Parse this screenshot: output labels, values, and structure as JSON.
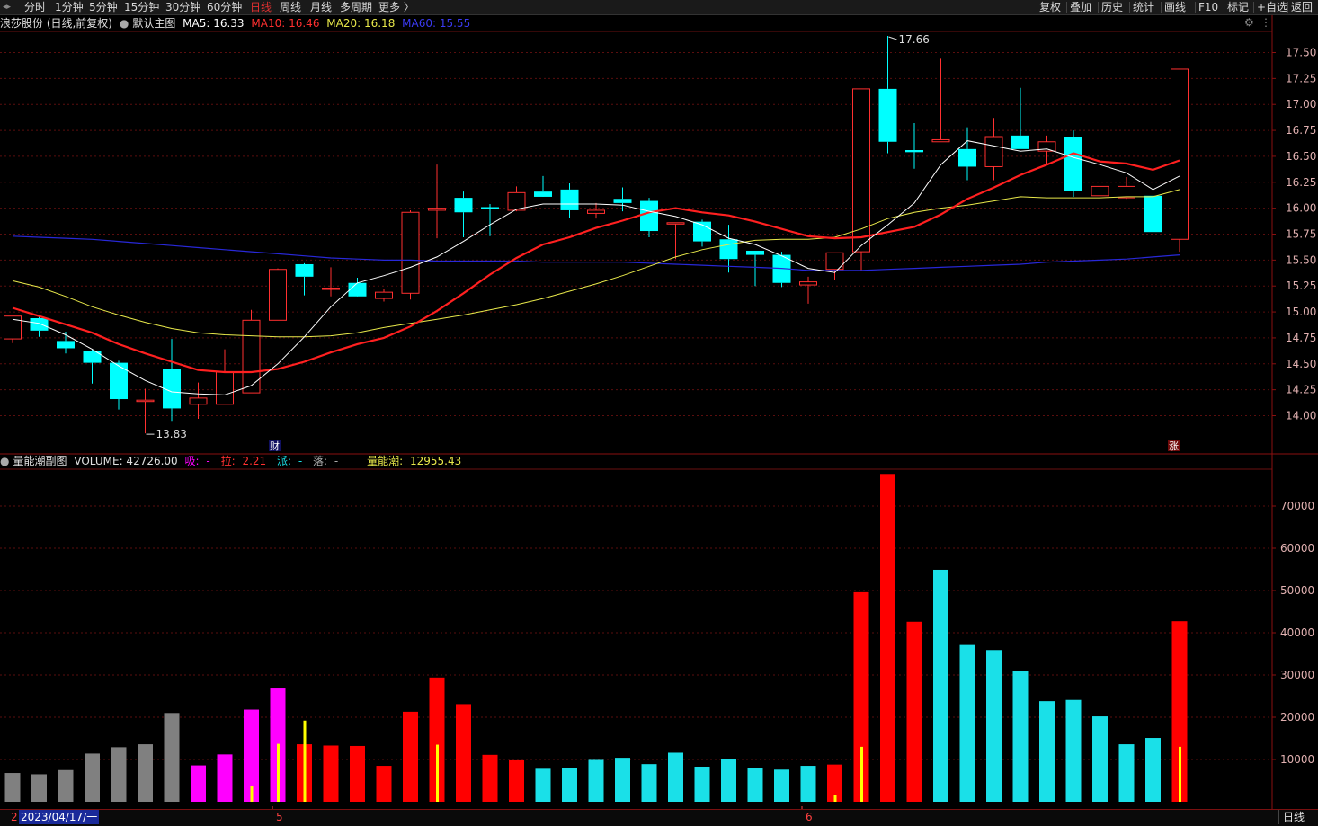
{
  "toolbar": {
    "periods": [
      "分时",
      "1分钟",
      "5分钟",
      "15分钟",
      "30分钟",
      "60分钟",
      "日线",
      "周线",
      "月线",
      "多周期",
      "更多 〉"
    ],
    "active_period": "日线",
    "right_buttons": [
      "复权",
      "叠加",
      "历史",
      "统计",
      "画线",
      "F10",
      "标记",
      "+自选",
      "返回"
    ]
  },
  "main_legend": {
    "stock": "浪莎股份 (日线,前复权)",
    "indicator": "默认主图",
    "ma5": "MA5: 16.33",
    "ma10": "MA10: 16.46",
    "ma20": "MA20: 16.18",
    "ma60": "MA60: 15.55"
  },
  "sub_legend": {
    "name": "量能潮副图",
    "volume": "VOLUME: 42726.00",
    "xi_label": "吸:",
    "xi_val": "-",
    "la_label": "拉:",
    "la_val": "2.21",
    "pai_label": "派:",
    "pai_val": "-",
    "luo_label": "落:",
    "luo_val": "-",
    "lnc_label": "量能潮:",
    "lnc_val": "12955.43"
  },
  "colors": {
    "up": "#ff3030",
    "down": "#00ffff",
    "ma5": "#ffffff",
    "ma10": "#ff2020",
    "ma20": "#e8e84a",
    "ma60": "#2828d8",
    "vol_gray": "#808080",
    "vol_magenta": "#ff00ff",
    "vol_red": "#ff0000",
    "vol_cyan": "#1ae0e8",
    "vol_yellow": "#ffff00"
  },
  "annotations": {
    "low": "13.83",
    "high": "17.66",
    "marker_cai": "财",
    "marker_zhang": "涨"
  },
  "bottom": {
    "date": "2023/04/17/一",
    "left_stub": "2",
    "month5": "5",
    "month6": "6",
    "mode": "日线"
  },
  "chart_data": [
    {
      "type": "candlestick",
      "ylim": [
        13.6,
        17.9
      ],
      "y_ticks": [
        "17.50",
        "17.25",
        "17.00",
        "16.75",
        "16.50",
        "16.25",
        "16.00",
        "15.75",
        "15.50",
        "15.25",
        "15.00",
        "14.75",
        "14.50",
        "14.25",
        "14.00"
      ],
      "ohlc": [
        [
          14.74,
          14.96,
          14.7,
          14.96
        ],
        [
          14.94,
          14.97,
          14.76,
          14.82
        ],
        [
          14.72,
          14.81,
          14.6,
          14.65
        ],
        [
          14.62,
          14.64,
          14.31,
          14.51
        ],
        [
          14.51,
          14.53,
          14.06,
          14.16
        ],
        [
          14.15,
          14.26,
          13.83,
          14.15
        ],
        [
          14.45,
          14.74,
          13.95,
          14.07
        ],
        [
          14.11,
          14.32,
          13.97,
          14.17
        ],
        [
          14.11,
          14.64,
          14.11,
          14.42
        ],
        [
          14.22,
          15.02,
          14.22,
          14.92
        ],
        [
          14.92,
          15.42,
          14.92,
          15.41
        ],
        [
          15.46,
          15.47,
          15.16,
          15.34
        ],
        [
          15.23,
          15.43,
          15.15,
          15.23
        ],
        [
          15.28,
          15.33,
          15.17,
          15.15
        ],
        [
          15.13,
          15.22,
          15.1,
          15.19
        ],
        [
          15.18,
          15.98,
          15.12,
          15.96
        ],
        [
          15.98,
          16.42,
          15.71,
          16.0
        ],
        [
          16.1,
          16.16,
          15.72,
          15.96
        ],
        [
          16.01,
          16.04,
          15.73,
          15.99
        ],
        [
          15.98,
          16.21,
          15.97,
          16.15
        ],
        [
          16.16,
          16.31,
          16.13,
          16.11
        ],
        [
          16.18,
          16.24,
          15.91,
          15.98
        ],
        [
          15.95,
          16.05,
          15.9,
          15.98
        ],
        [
          16.09,
          16.2,
          15.97,
          16.05
        ],
        [
          16.07,
          16.1,
          15.72,
          15.78
        ],
        [
          15.86,
          15.86,
          15.51,
          15.86
        ],
        [
          15.87,
          15.89,
          15.63,
          15.68
        ],
        [
          15.7,
          15.84,
          15.38,
          15.51
        ],
        [
          15.59,
          15.59,
          15.25,
          15.55
        ],
        [
          15.55,
          15.58,
          15.24,
          15.28
        ],
        [
          15.26,
          15.34,
          15.08,
          15.29
        ],
        [
          15.41,
          15.54,
          15.31,
          15.57
        ],
        [
          15.58,
          17.15,
          15.4,
          17.15
        ],
        [
          17.15,
          17.66,
          16.53,
          16.64
        ],
        [
          16.56,
          16.82,
          16.38,
          16.54
        ],
        [
          16.64,
          17.44,
          16.64,
          16.66
        ],
        [
          16.57,
          16.78,
          16.27,
          16.4
        ],
        [
          16.4,
          16.87,
          16.27,
          16.69
        ],
        [
          16.7,
          17.16,
          16.57,
          16.57
        ],
        [
          16.55,
          16.7,
          16.43,
          16.64
        ],
        [
          16.69,
          16.75,
          16.11,
          16.17
        ],
        [
          16.12,
          16.34,
          16.0,
          16.21
        ],
        [
          16.1,
          16.3,
          16.09,
          16.21
        ],
        [
          16.12,
          16.2,
          15.73,
          15.77
        ],
        [
          15.7,
          17.34,
          15.58,
          17.34
        ]
      ],
      "ma5": [
        14.93,
        14.89,
        14.78,
        14.64,
        14.48,
        14.34,
        14.23,
        14.21,
        14.2,
        14.29,
        14.5,
        14.76,
        15.05,
        15.28,
        15.35,
        15.43,
        15.53,
        15.68,
        15.84,
        15.99,
        16.04,
        16.04,
        16.04,
        16.03,
        15.97,
        15.92,
        15.84,
        15.71,
        15.65,
        15.54,
        15.42,
        15.38,
        15.64,
        15.84,
        16.05,
        16.42,
        16.65,
        16.6,
        16.55,
        16.57,
        16.49,
        16.42,
        16.34,
        16.18,
        16.31
      ],
      "ma10": [
        15.04,
        14.96,
        14.88,
        14.8,
        14.69,
        14.6,
        14.52,
        14.44,
        14.42,
        14.42,
        14.45,
        14.52,
        14.61,
        14.69,
        14.75,
        14.86,
        15.01,
        15.18,
        15.36,
        15.52,
        15.65,
        15.72,
        15.81,
        15.88,
        15.96,
        16.0,
        15.96,
        15.93,
        15.87,
        15.8,
        15.73,
        15.71,
        15.72,
        15.77,
        15.82,
        15.94,
        16.09,
        16.2,
        16.32,
        16.42,
        16.53,
        16.45,
        16.43,
        16.37,
        16.46
      ],
      "ma20": [
        15.3,
        15.24,
        15.15,
        15.05,
        14.97,
        14.9,
        14.84,
        14.8,
        14.78,
        14.77,
        14.76,
        14.76,
        14.77,
        14.8,
        14.85,
        14.89,
        14.93,
        14.97,
        15.02,
        15.07,
        15.13,
        15.2,
        15.27,
        15.35,
        15.44,
        15.53,
        15.6,
        15.65,
        15.69,
        15.7,
        15.7,
        15.72,
        15.8,
        15.9,
        15.96,
        16.0,
        16.03,
        16.07,
        16.11,
        16.1,
        16.1,
        16.1,
        16.11,
        16.11,
        16.18
      ],
      "ma60": [
        15.73,
        15.72,
        15.71,
        15.7,
        15.68,
        15.66,
        15.64,
        15.62,
        15.6,
        15.58,
        15.56,
        15.54,
        15.52,
        15.51,
        15.5,
        15.5,
        15.49,
        15.49,
        15.49,
        15.49,
        15.48,
        15.48,
        15.48,
        15.48,
        15.47,
        15.46,
        15.45,
        15.44,
        15.43,
        15.42,
        15.4,
        15.4,
        15.4,
        15.41,
        15.42,
        15.43,
        15.44,
        15.45,
        15.46,
        15.48,
        15.49,
        15.5,
        15.51,
        15.53,
        15.55
      ]
    },
    {
      "type": "bar",
      "ylim": [
        0,
        80000
      ],
      "y_ticks": [
        "70000",
        "60000",
        "50000",
        "40000",
        "30000",
        "20000",
        "10000"
      ],
      "volume": [
        6800,
        6500,
        7500,
        11400,
        12900,
        13600,
        21000,
        8600,
        11200,
        21800,
        26800,
        13600,
        13300,
        13200,
        8500,
        21300,
        29400,
        23100,
        11100,
        9800,
        7800,
        8000,
        9900,
        10400,
        8900,
        11600,
        8300,
        10000,
        7900,
        7600,
        8500,
        8800,
        49600,
        77600,
        42600,
        54900,
        37100,
        35900,
        30900,
        23800,
        24100,
        20200,
        13600,
        15100,
        42726
      ],
      "color_class": [
        "gray",
        "gray",
        "gray",
        "gray",
        "gray",
        "gray",
        "gray",
        "magenta",
        "magenta",
        "magenta",
        "magenta",
        "red",
        "red",
        "red",
        "red",
        "red",
        "red",
        "red",
        "red",
        "red",
        "cyan",
        "cyan",
        "cyan",
        "cyan",
        "cyan",
        "cyan",
        "cyan",
        "cyan",
        "cyan",
        "cyan",
        "cyan",
        "red",
        "red",
        "red",
        "red",
        "cyan",
        "cyan",
        "cyan",
        "cyan",
        "cyan",
        "cyan",
        "cyan",
        "cyan",
        "cyan",
        "red"
      ],
      "yellow_line": [
        0,
        0,
        0,
        0,
        0,
        0,
        0,
        0,
        0,
        3800,
        13700,
        19200,
        0,
        0,
        0,
        0,
        13500,
        0,
        0,
        0,
        0,
        0,
        0,
        0,
        0,
        0,
        0,
        0,
        0,
        0,
        0,
        1500,
        13000,
        0,
        0,
        0,
        0,
        0,
        0,
        0,
        0,
        0,
        0,
        0,
        13000
      ]
    }
  ]
}
